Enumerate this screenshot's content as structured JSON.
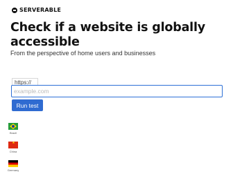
{
  "brand": {
    "name": "SERVERABLE",
    "icon": "serverable-logo-icon"
  },
  "hero": {
    "title": "Check if a website is globally accessible",
    "subtitle": "From the perspective of home users and businesses"
  },
  "form": {
    "prefix": "https://",
    "placeholder": "example.com",
    "value": "",
    "button_label": "Run test",
    "accent_color": "#2f6bd1"
  },
  "locations": [
    {
      "label": "Brazil",
      "icon": "brazil-flag-icon"
    },
    {
      "label": "China",
      "icon": "china-flag-icon"
    },
    {
      "label": "Germany",
      "icon": "germany-flag-icon"
    }
  ]
}
